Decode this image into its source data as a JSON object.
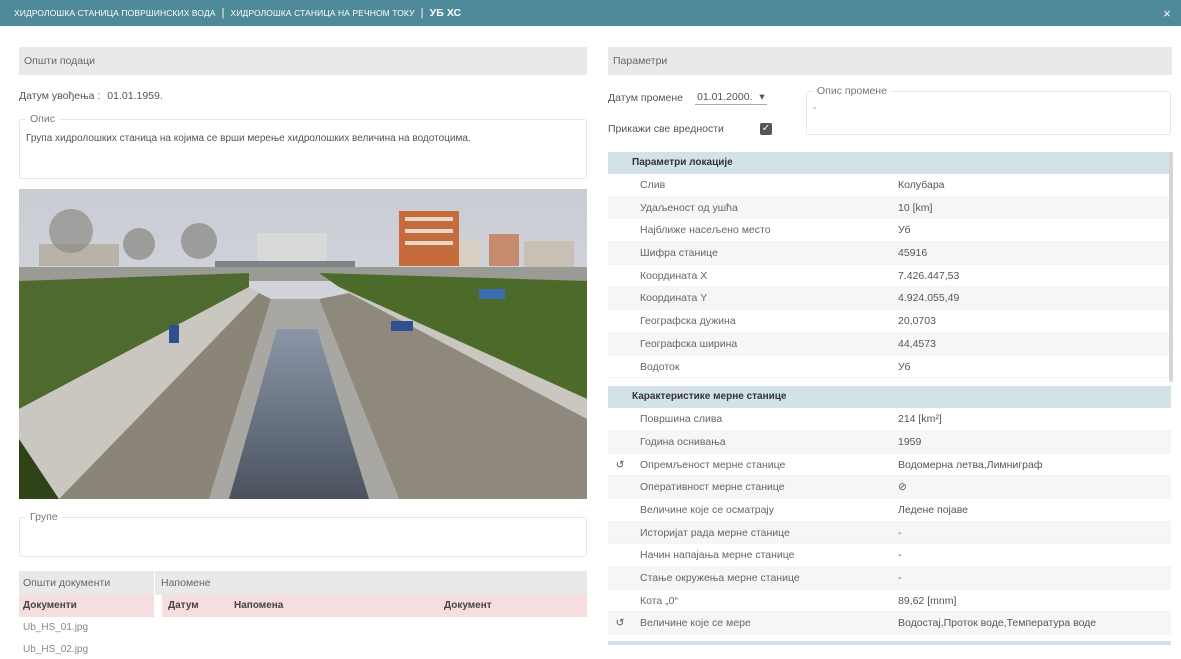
{
  "breadcrumb": {
    "item1": "ХИДРОЛОШКА СТАНИЦА ПОВРШИНСКИХ ВОДА",
    "item2": "ХИДРОЛОШКА СТАНИЦА НА РЕЧНОМ ТОКУ",
    "item3": "УБ ХС",
    "sep": "|",
    "close": "×"
  },
  "general": {
    "header": "Општи подаци",
    "date_label": "Датум увођења :",
    "date_value": "01.01.1959.",
    "description_legend": "Опис",
    "description_text": "Група хидролошких станица на којима се врши мерење хидролошких величина на водотоцима.",
    "groups_legend": "Групе"
  },
  "bottom": {
    "tab_documents": "Општи документи",
    "tab_notes": "Напомене",
    "documents_header": "Документи",
    "documents": [
      "Ub_HS_01.jpg",
      "Ub_HS_02.jpg"
    ],
    "notes_columns": [
      "Датум",
      "Напомена",
      "Документ"
    ]
  },
  "parameters": {
    "header": "Параметри",
    "change_date_label": "Датум промене",
    "change_date_value": "01.01.2000.",
    "show_all_label": "Прикажи све вредности",
    "show_all_checked": true,
    "change_desc_legend": "Опис промене",
    "change_desc_value": "-",
    "location_group": "Параметри локације",
    "location_rows": [
      {
        "key": "Слив",
        "value": "Колубара"
      },
      {
        "key": "Удаљеност од ушћа",
        "value": "10  [km]"
      },
      {
        "key": "Најближе насељено место",
        "value": "Уб"
      },
      {
        "key": "Шифра станице",
        "value": "45916"
      },
      {
        "key": "Координата X",
        "value": "7.426.447,53"
      },
      {
        "key": "Координата Y",
        "value": "4.924.055,49"
      },
      {
        "key": "Географска дужина",
        "value": "20,0703"
      },
      {
        "key": "Географска ширина",
        "value": "44,4573"
      },
      {
        "key": "Водоток",
        "value": "Уб"
      }
    ],
    "station_group": "Карактеристике мерне станице",
    "station_rows": [
      {
        "key": "Површина слива",
        "value": "214  [km²]",
        "history": false
      },
      {
        "key": "Година оснивања",
        "value": "1959",
        "history": false
      },
      {
        "key": "Опремљеност мерне станице",
        "value": "Водомерна летва,Лимниграф",
        "history": true
      },
      {
        "key": "Оперативност мерне станице",
        "value": "⊘",
        "history": false
      },
      {
        "key": "Величине које се осматрају",
        "value": "Ледене појаве",
        "history": false
      },
      {
        "key": "Историјат рада мерне станице",
        "value": "-",
        "history": false
      },
      {
        "key": "Начин напајања мерне станице",
        "value": "-",
        "history": false
      },
      {
        "key": "Стање окружења мерне станице",
        "value": "-",
        "history": false
      },
      {
        "key": "Кота „0“",
        "value": "89,62  [mnm]",
        "history": false
      },
      {
        "key": "Величине које се мере",
        "value": "Водостај,Проток воде,Температура воде",
        "history": true
      }
    ]
  },
  "icons": {
    "history": "↺",
    "dropdown": "▾",
    "check": "✓"
  },
  "colors": {
    "topbar": "#4e8a99",
    "group_header": "#d2e2e6",
    "doc_header": "#f6dde0"
  }
}
